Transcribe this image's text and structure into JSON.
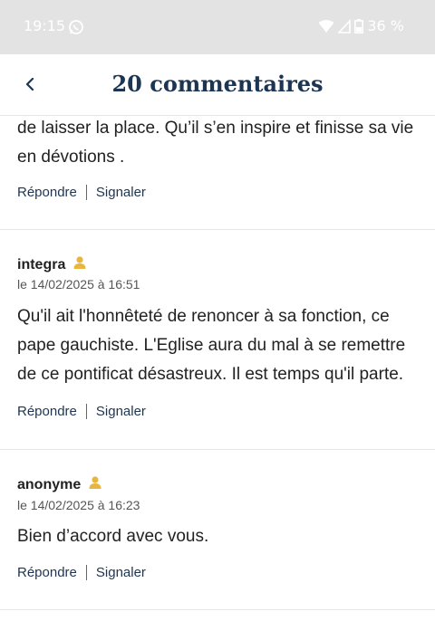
{
  "status": {
    "time": "19:15",
    "battery": "36 %"
  },
  "header": {
    "title": "20 commentaires"
  },
  "comments": [
    {
      "text": "de laisser la place. Qu’il s’en inspire et finisse sa vie en dévotions .",
      "reply": "Répondre",
      "report": "Signaler"
    },
    {
      "author": "integra",
      "date": "le 14/02/2025 à 16:51",
      "text": "Qu'il ait l'honnêteté de renoncer à sa fonction, ce pape gauchiste. L'Eglise aura du mal à se remettre de ce pontificat désastreux. Il est temps qu'il parte.",
      "reply": "Répondre",
      "report": "Signaler"
    },
    {
      "author": "anonyme",
      "date": "le 14/02/2025 à 16:23",
      "text": "Bien d’accord avec vous.",
      "reply": "Répondre",
      "report": "Signaler"
    }
  ],
  "colors": {
    "accent": "#1c3553",
    "user_icon": "#e8b53e",
    "status_bar": "#e3e3e3"
  }
}
